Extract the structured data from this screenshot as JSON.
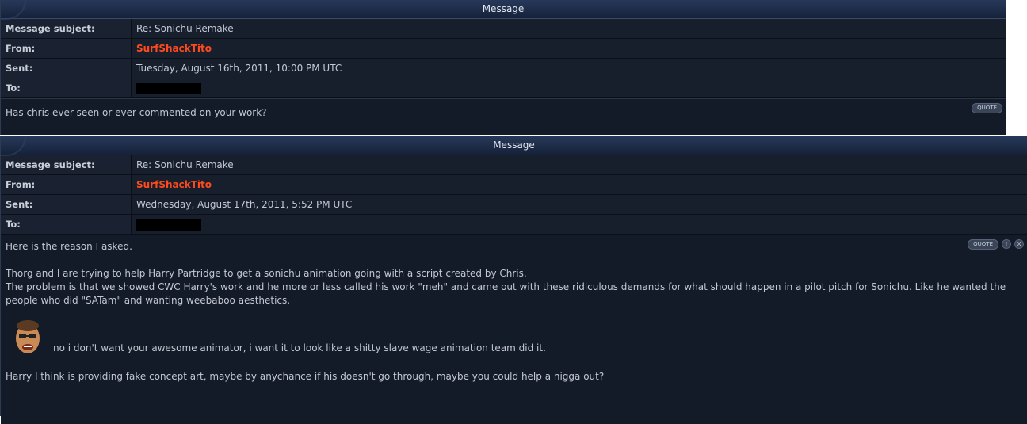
{
  "messages": [
    {
      "header": "Message",
      "subject_label": "Message subject:",
      "subject": "Re: Sonichu Remake",
      "from_label": "From:",
      "from": "SurfShackTito",
      "sent_label": "Sent:",
      "sent": "Tuesday, August 16th, 2011, 10:00 PM UTC",
      "to_label": "To:",
      "quote_label": "QUOTE",
      "body": [
        "Has chris ever seen or ever commented on your work?"
      ]
    },
    {
      "header": "Message",
      "subject_label": "Message subject:",
      "subject": "Re: Sonichu Remake",
      "from_label": "From:",
      "from": "SurfShackTito",
      "sent_label": "Sent:",
      "sent": "Wednesday, August 17th, 2011, 5:52 PM UTC",
      "to_label": "To:",
      "quote_label": "QUOTE",
      "report_label": "!",
      "delete_label": "X",
      "body": [
        "Here is the reason I asked.",
        "Thorg and I are trying to help Harry Partridge to get a sonichu animation going with a script created by Chris.",
        "The problem is that we showed CWC Harry's work and he more or less called his work \"meh\" and came out with these ridiculous demands for what should happen in a pilot pitch for Sonichu. Like he wanted the people who did \"SATam\" and wanting weebaboo aesthetics.",
        "no i don't want your awesome animator, i want it to look like a shitty slave wage animation team did it.",
        "Harry I think is providing fake concept art, maybe by anychance if his doesn't go through, maybe you could help a nigga out?"
      ]
    }
  ],
  "colors": {
    "username": "#ff4a1c",
    "panel_bg": "#141b28",
    "header_bg": "#1e2c48"
  },
  "icons": [
    "quote-button",
    "report-icon",
    "delete-icon",
    "face-emoticon"
  ]
}
